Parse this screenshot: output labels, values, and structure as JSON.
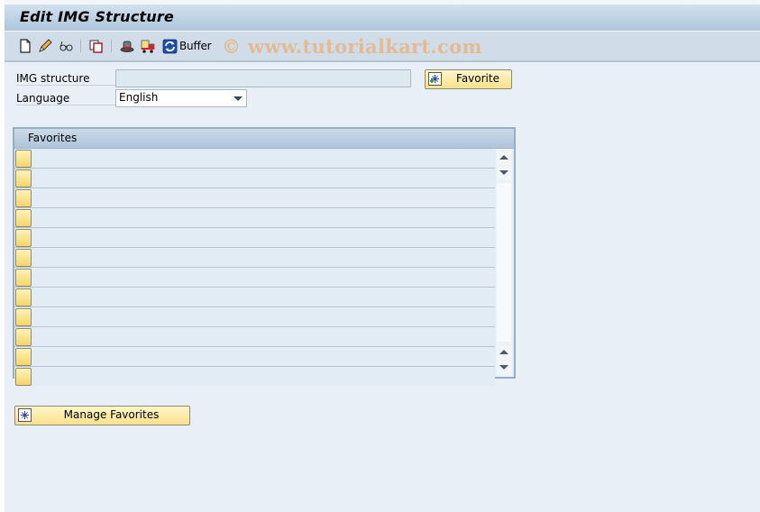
{
  "window": {
    "title": "Edit IMG Structure"
  },
  "toolbar": {
    "icons": [
      "new-document-icon",
      "edit-pencil-icon",
      "display-glasses-icon",
      "copy-icon",
      "hat-icon",
      "transport-truck-icon",
      "refresh-icon"
    ],
    "buffer_label": "Buffer",
    "watermark": "© www.tutorialkart.com"
  },
  "form": {
    "img_structure": {
      "label": "IMG structure",
      "value": ""
    },
    "language": {
      "label": "Language",
      "value": "English"
    },
    "favorite_button": "Favorite"
  },
  "favorites_table": {
    "header": "Favorites",
    "rows": [
      "",
      "",
      "",
      "",
      "",
      "",
      "",
      "",
      "",
      "",
      "",
      ""
    ]
  },
  "manage_favorites_button": "Manage Favorites"
}
